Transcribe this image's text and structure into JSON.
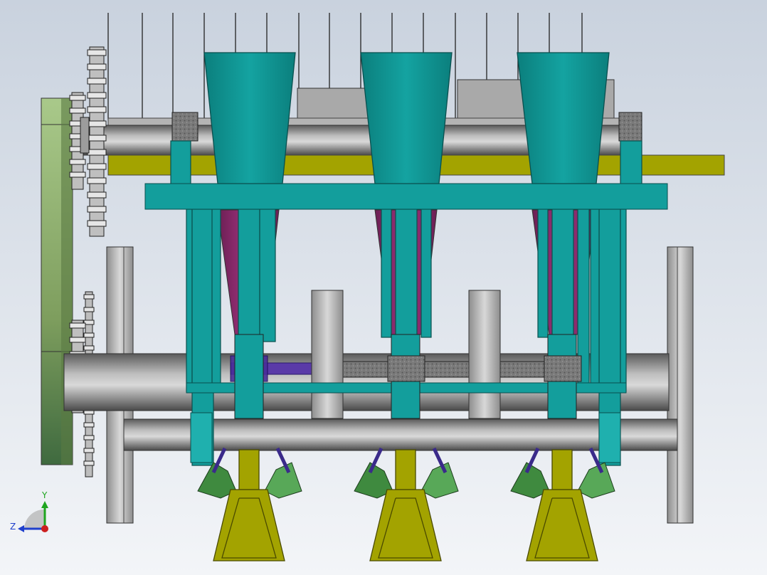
{
  "viewport": {
    "background_top": "#c9d2de",
    "background_bottom": "#f3f5f8"
  },
  "colors": {
    "frame_teal": "#139e9c",
    "hopper_teal": "#0f9a98",
    "funnel_magenta": "#8b2a6c",
    "plate_olive": "#a3a300",
    "furrow_green": "#4b9c4b",
    "side_plate_green": "#8fb066",
    "shaft_grey": "#8a8a8a",
    "wheel_grey": "#c8c8c8",
    "purple_rod": "#5a3aa8",
    "triad_x_red": "#cc1f1f",
    "triad_y_green": "#1fa51f",
    "triad_z_blue": "#1f3fcc"
  },
  "triad": {
    "y_label": "Y",
    "z_label": "Z"
  }
}
